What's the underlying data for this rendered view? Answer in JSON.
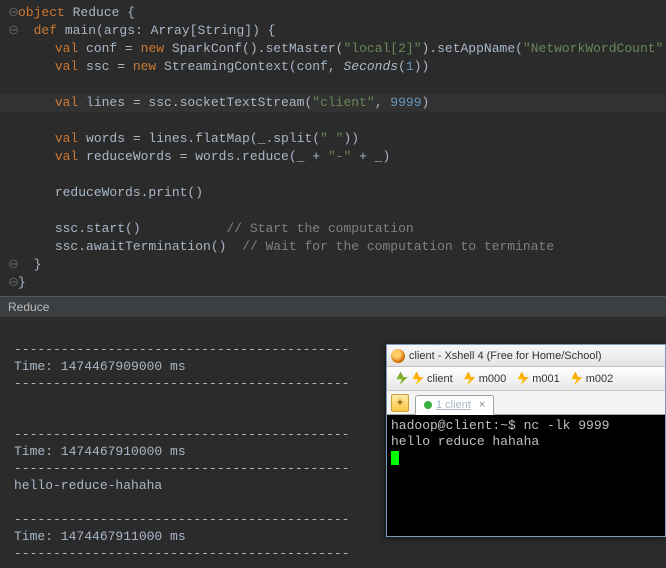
{
  "editor": {
    "object_kw": "object",
    "object_name": "Reduce",
    "lbrace": " {",
    "def_kw": "def",
    "main_sig1": " main(args: Array[",
    "string_type": "String",
    "main_sig2": "]) {",
    "val_kw": "val",
    "conf_name": " conf = ",
    "new_kw": "new",
    "sparkconf": " SparkConf().setMaster(",
    "local2": "\"local[2]\"",
    "setappname": ").setAppName(",
    "appname": "\"NetworkWordCount\"",
    "ssc_name": " ssc = ",
    "streamctx": " StreamingContext(conf, ",
    "seconds": "Seconds",
    "one": "1",
    "close2": "))",
    "lines_name": " lines = ssc.socketTextStream(",
    "client_str": "\"client\"",
    "comma": ", ",
    "port": "9999",
    "close1": ")",
    "words_name": " words = lines.flatMap(_.split(",
    "space_str": "\" \"",
    "reducewords_name": " reduceWords = words.reduce(_ + ",
    "dash_str": "\"-\"",
    "plus_end": " + _)",
    "print_call": "reduceWords.print()",
    "start_call": "ssc.start()",
    "start_comment": "// Start the computation",
    "await_call": "ssc.awaitTermination()",
    "await_comment": "// Wait for the computation to terminate",
    "rbrace": "}"
  },
  "separator": {
    "label": "Reduce"
  },
  "console": {
    "dashes": "-------------------------------------------",
    "time1": "Time: 1474467909000 ms",
    "time2": "Time: 1474467910000 ms",
    "output": "hello-reduce-hahaha",
    "time3": "Time: 1474467911000 ms"
  },
  "xshell": {
    "title": "client - Xshell 4 (Free for Home/School)",
    "toolbar": {
      "client": "client",
      "m000": "m000",
      "m001": "m001",
      "m002": "m002"
    },
    "tab": {
      "label": "1 client",
      "add": "+",
      "close": "×"
    },
    "terminal": {
      "line1": "hadoop@client:~$ nc -lk 9999",
      "line2": "hello reduce hahaha"
    }
  }
}
